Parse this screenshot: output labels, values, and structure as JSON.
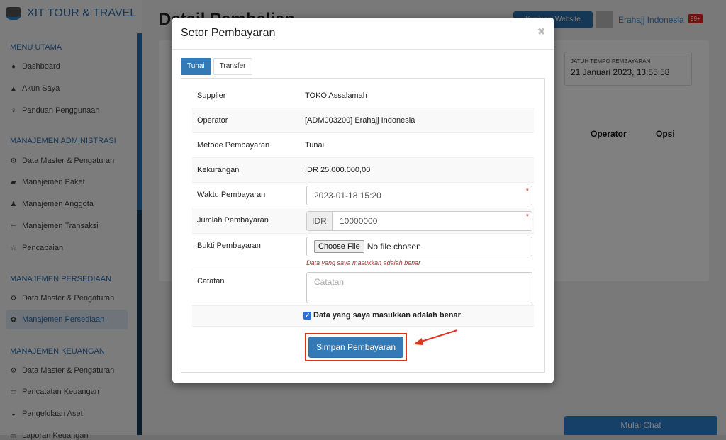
{
  "sidebar": {
    "brand": "XIT TOUR & TRAVEL",
    "sections": [
      {
        "title": "MENU UTAMA",
        "items": [
          {
            "label": "Dashboard",
            "icon": "globe-icon"
          },
          {
            "label": "Akun Saya",
            "icon": "user-icon"
          },
          {
            "label": "Panduan Penggunaan",
            "icon": "lightbulb-icon"
          }
        ]
      },
      {
        "title": "MANAJEMEN ADMINISTRASI",
        "items": [
          {
            "label": "Data Master & Pengaturan",
            "icon": "gears-icon"
          },
          {
            "label": "Manajemen Paket",
            "icon": "book-icon"
          },
          {
            "label": "Manajemen Anggota",
            "icon": "users-icon"
          },
          {
            "label": "Manajemen Transaksi",
            "icon": "cart-icon"
          },
          {
            "label": "Pencapaian",
            "icon": "star-icon"
          }
        ]
      },
      {
        "title": "MANAJEMEN PERSEDIAAN",
        "items": [
          {
            "label": "Data Master & Pengaturan",
            "icon": "gears-icon"
          },
          {
            "label": "Manajemen Persediaan",
            "icon": "cubes-icon",
            "active": true
          }
        ]
      },
      {
        "title": "MANAJEMEN KEUANGAN",
        "items": [
          {
            "label": "Data Master & Pengaturan",
            "icon": "gears-icon"
          },
          {
            "label": "Pencatatan Keuangan",
            "icon": "money-icon"
          },
          {
            "label": "Pengelolaan Aset",
            "icon": "hdd-icon"
          },
          {
            "label": "Laporan Keuangan",
            "icon": "money-icon"
          }
        ]
      }
    ]
  },
  "header": {
    "page_title": "Detail Pembelian",
    "website_button": "Kunjungi Website",
    "user_name": "Erahajj Indonesia",
    "notif_badge": "99+"
  },
  "main": {
    "due_label": "JATUH TEMPO PEMBAYARAN",
    "due_value": "21 Januari 2023, 13:55:58",
    "col_operator": "Operator",
    "col_opsi": "Opsi",
    "chat_button": "Mulai Chat"
  },
  "modal": {
    "title": "Setor Pembayaran",
    "tabs": [
      "Tunai",
      "Transfer"
    ],
    "rows": [
      {
        "label": "Supplier",
        "value": "TOKO Assalamah"
      },
      {
        "label": "Operator",
        "value": "[ADM003200] Erahajj Indonesia"
      },
      {
        "label": "Metode Pembayaran",
        "value": "Tunai"
      },
      {
        "label": "Kekurangan",
        "value": "IDR 25.000.000,00"
      }
    ],
    "waktu_label": "Waktu Pembayaran",
    "waktu_value": "2023-01-18 15:20",
    "jumlah_label": "Jumlah Pembayaran",
    "jumlah_prefix": "IDR",
    "jumlah_value": "10000000",
    "bukti_label": "Bukti Pembayaran",
    "file_button": "Choose File",
    "file_status": "No file chosen",
    "bukti_hint": "Data yang saya masukkan adalah benar",
    "catatan_label": "Catatan",
    "catatan_placeholder": "Catatan",
    "confirm_label": "Data yang saya masukkan adalah benar",
    "confirm_checked": true,
    "save_button": "Simpan Pembayaran",
    "required_mark": "*"
  },
  "colors": {
    "primary": "#337ab7",
    "highlight": "#e0341e"
  }
}
